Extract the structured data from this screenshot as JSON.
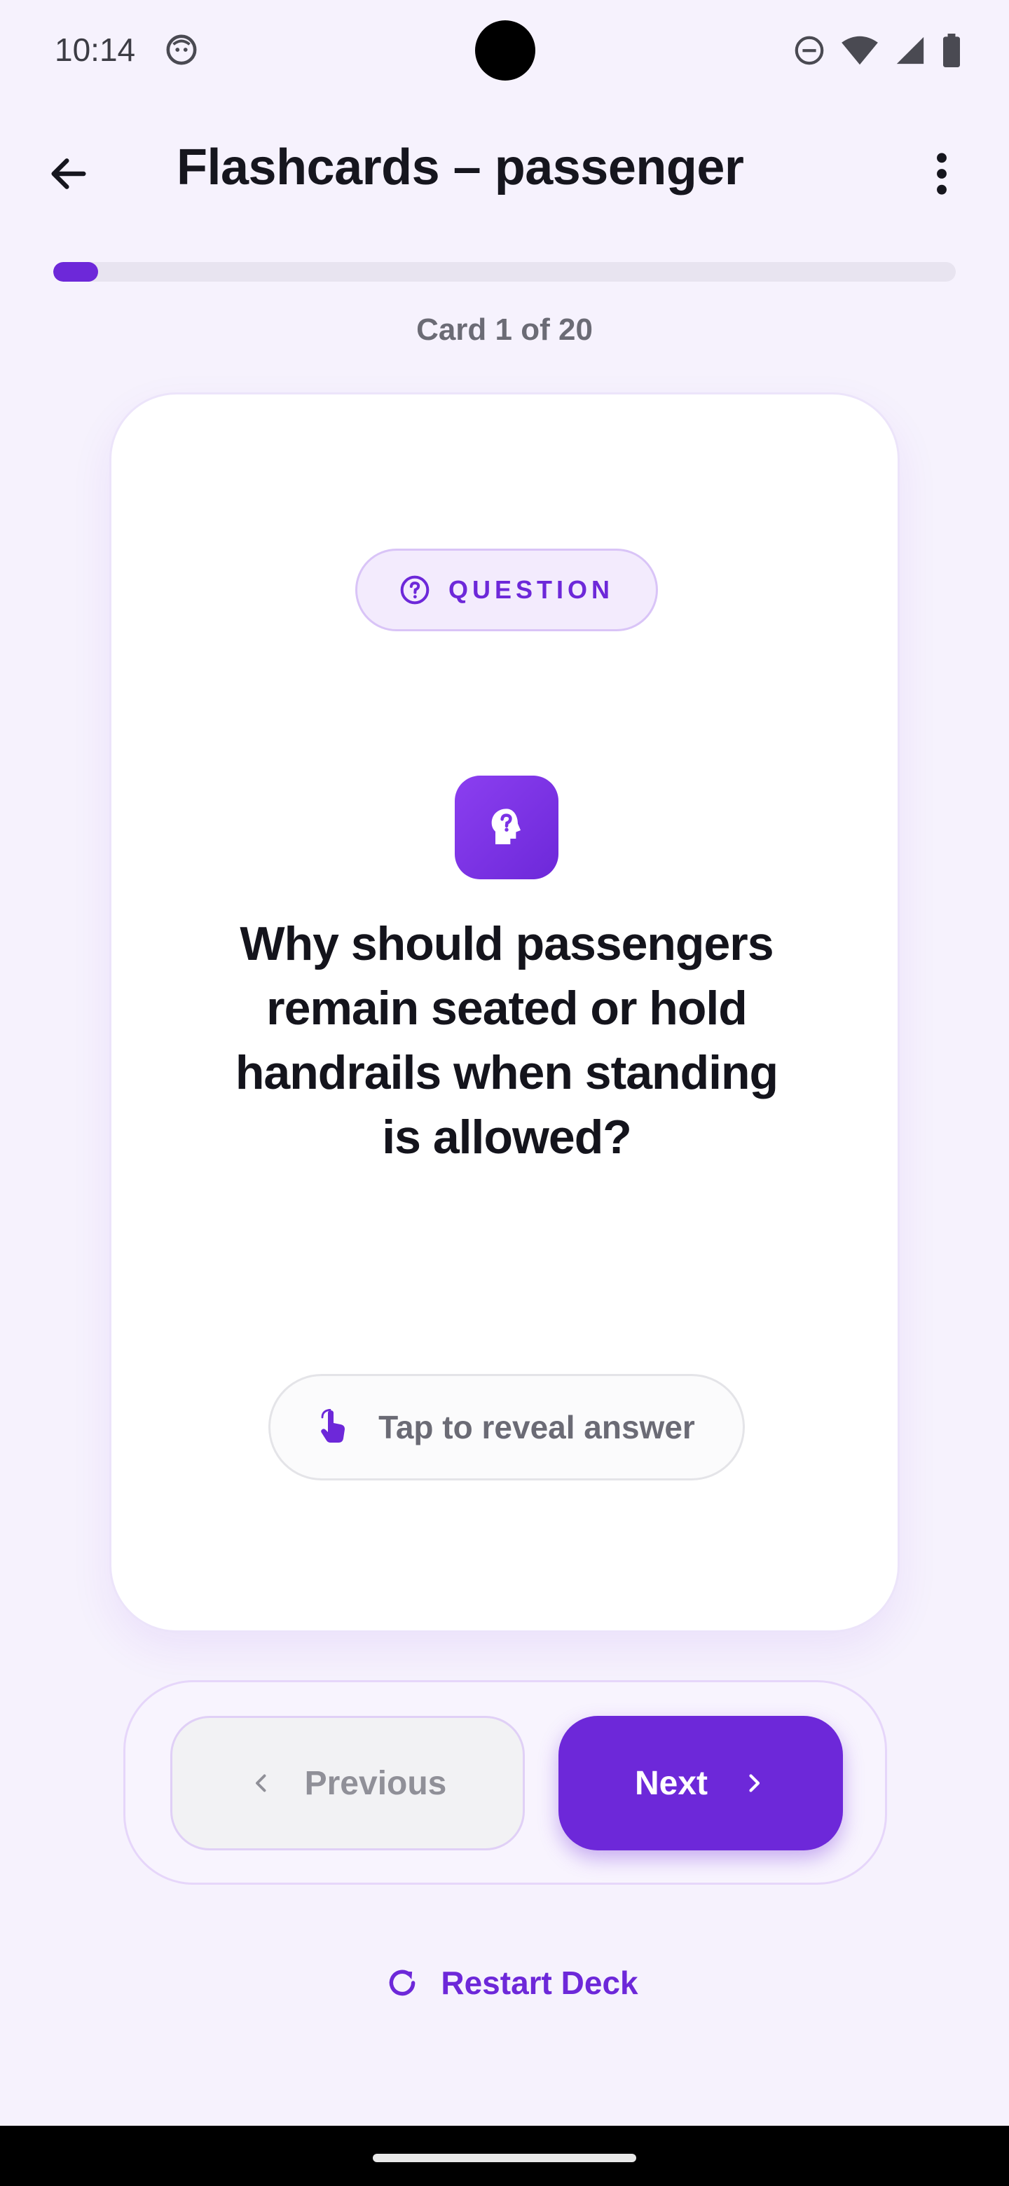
{
  "status_bar": {
    "time": "10:14",
    "icons": [
      "android-face-icon",
      "dnd-icon",
      "wifi-icon",
      "signal-icon",
      "battery-icon"
    ]
  },
  "app_bar": {
    "title": "Flashcards – passenger",
    "back_icon": "arrow-left-icon",
    "menu_icon": "more-vertical-icon"
  },
  "progress": {
    "fraction": 0.05,
    "counter_text": "Card 1 of 20"
  },
  "card": {
    "chip_label": "QUESTION",
    "chip_icon": "help-circle-icon",
    "head_icon": "head-question-icon",
    "question": "Why should passengers remain seated or hold handrails when standing is allowed?",
    "reveal_label": "Tap to reveal answer",
    "reveal_icon": "tap-hand-icon"
  },
  "navigation": {
    "previous_label": "Previous",
    "next_label": "Next",
    "restart_label": "Restart Deck"
  },
  "colors": {
    "accent": "#6d28d9",
    "background": "#f6f2fd",
    "text_dark": "#14141c",
    "text_muted": "#6b6b75"
  }
}
